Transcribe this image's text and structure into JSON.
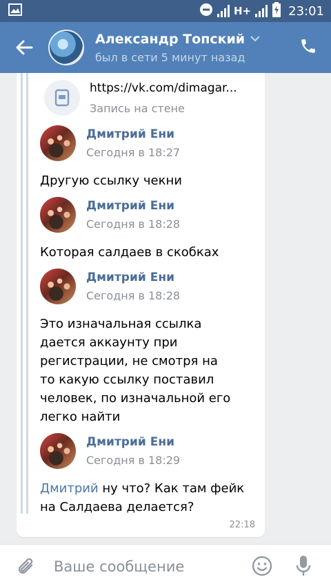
{
  "status_bar": {
    "time": "23:01",
    "network": "H+"
  },
  "header": {
    "name": "Александр Топский",
    "status": "был в сети 5 минут назад"
  },
  "link_card": {
    "url": "https://vk.com/dimagar...",
    "subtitle": "Запись на стене"
  },
  "messages": [
    {
      "author": "Дмитрий Ени",
      "time": "Сегодня в 18:27",
      "text": "Другую ссылку чекни"
    },
    {
      "author": "Дмитрий Ени",
      "time": "Сегодня в 18:28",
      "text": "Которая салдаев в скобках"
    },
    {
      "author": "Дмитрий Ени",
      "time": "Сегодня в 18:28",
      "lines": [
        "Это изначальная ссылка",
        "дается аккаунту при",
        "регистрации, не смотря на",
        "то какую ссылку поставил",
        "человек, по изначальной его",
        "легко найти"
      ]
    },
    {
      "author": "Дмитрий Ени",
      "time": "Сегодня в 18:29",
      "mention": "Дмитрий",
      "line1": " ну что? Как там фейк",
      "line2": "на Салдаева делается?"
    }
  ],
  "bubble_time": "22:18",
  "composer": {
    "placeholder": "Ваше сообщение"
  },
  "colors": {
    "header": "#5181b8",
    "status_bar": "#3e5f8a",
    "name": "#4a6d99",
    "link": "#4a76a8"
  }
}
